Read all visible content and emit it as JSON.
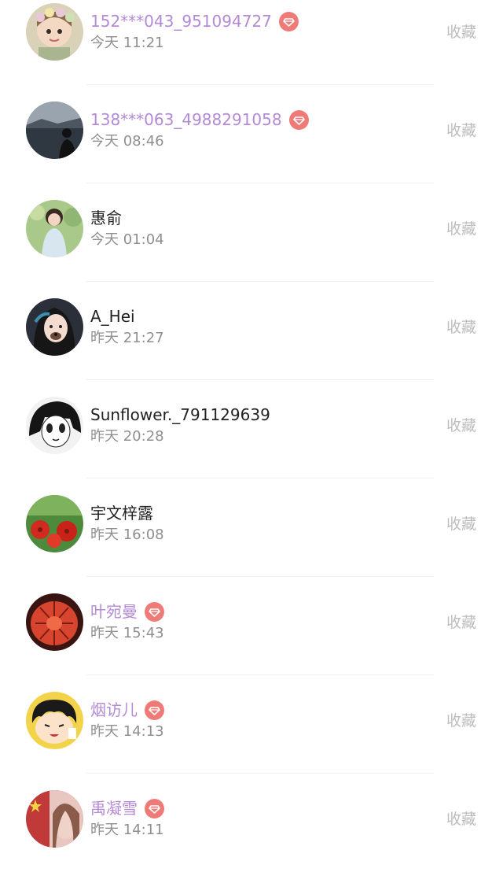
{
  "colors": {
    "vip_name": "#b48ad6",
    "normal_name": "#222222",
    "time": "#8f8f8f",
    "favorite": "#bdbdbd",
    "vip_badge": "#ee7b78"
  },
  "rows": [
    {
      "name": "152***043_951094727",
      "vip": true,
      "time": "今天 11:21",
      "action": "收藏",
      "avatar": "girl-flower-crown-avatar"
    },
    {
      "name": "138***063_4988291058",
      "vip": true,
      "time": "今天 08:46",
      "action": "收藏",
      "avatar": "lake-silhouette-avatar"
    },
    {
      "name": "惠俞",
      "vip": false,
      "time": "今天 01:04",
      "action": "收藏",
      "avatar": "girl-garden-avatar"
    },
    {
      "name": "A_Hei",
      "vip": false,
      "time": "昨天 21:27",
      "action": "收藏",
      "avatar": "girl-dog-filter-avatar"
    },
    {
      "name": "Sunflower._791129639",
      "vip": false,
      "time": "昨天 20:28",
      "action": "收藏",
      "avatar": "manga-girl-avatar"
    },
    {
      "name": "宇文梓露",
      "vip": false,
      "time": "昨天 16:08",
      "action": "收藏",
      "avatar": "red-flowers-avatar"
    },
    {
      "name": "叶宛曼",
      "vip": true,
      "time": "昨天 15:43",
      "action": "收藏",
      "avatar": "red-cactus-avatar"
    },
    {
      "name": "烟访儿",
      "vip": true,
      "time": "昨天 14:13",
      "action": "收藏",
      "avatar": "cartoon-girl-avatar"
    },
    {
      "name": "禹凝雪",
      "vip": true,
      "time": "昨天 14:11",
      "action": "收藏",
      "avatar": "flag-face-avatar"
    }
  ]
}
